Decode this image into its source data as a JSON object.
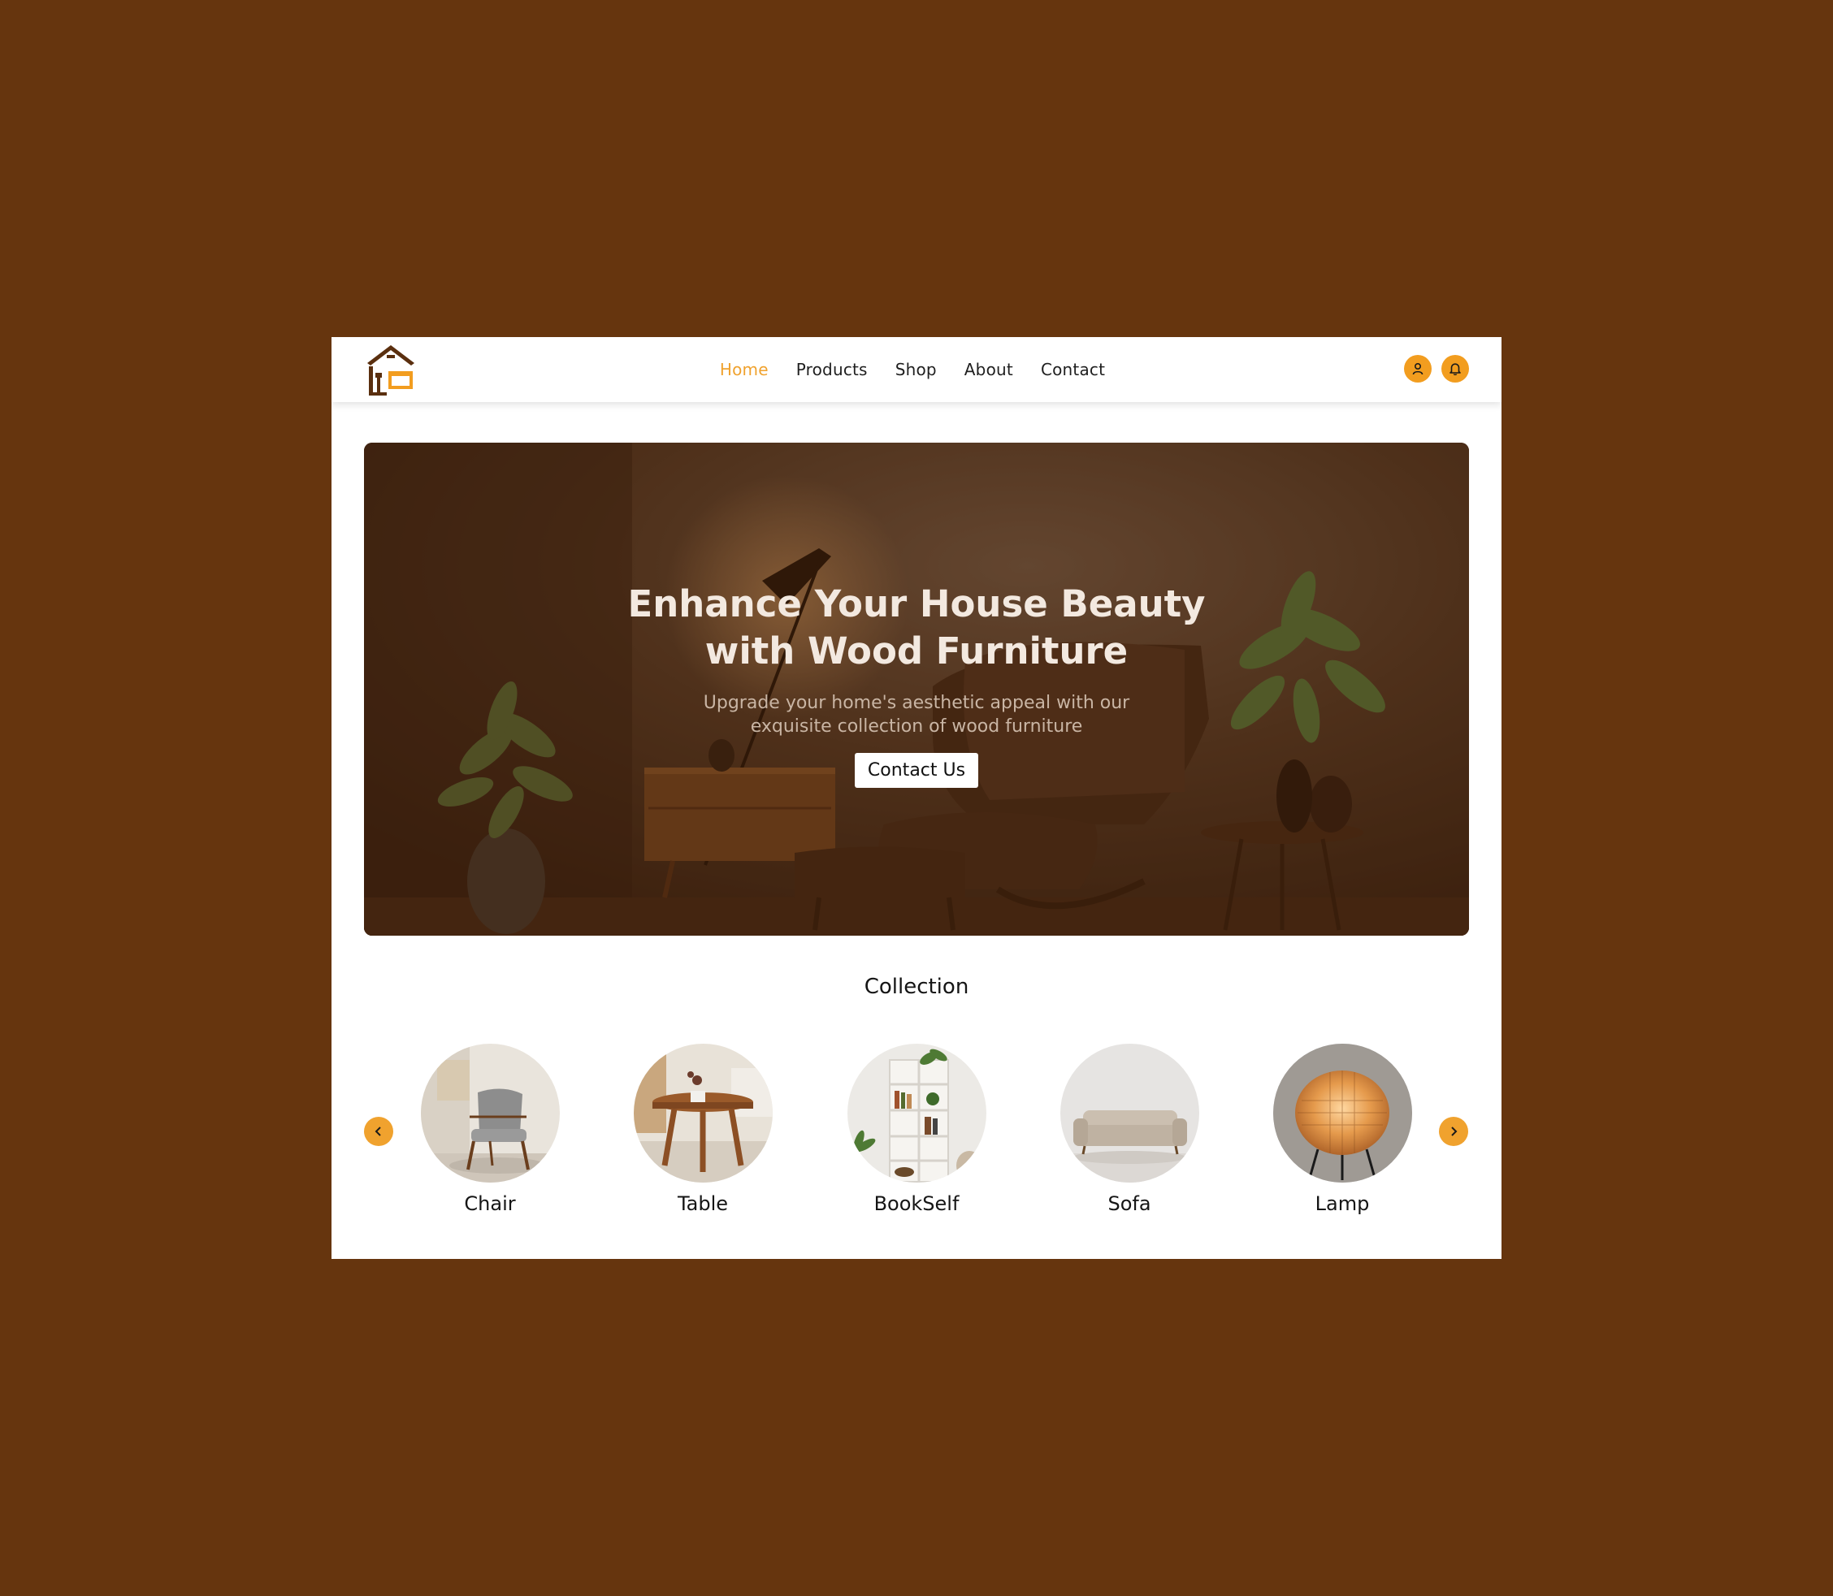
{
  "nav": {
    "links": [
      "Home",
      "Products",
      "Shop",
      "About",
      "Contact"
    ],
    "active": "Home",
    "icons": [
      "user-icon",
      "bell-icon"
    ]
  },
  "hero": {
    "title": "Enhance Your House Beauty with Wood Furniture",
    "subtitle": "Upgrade your home's aesthetic appeal with our exquisite collection of wood furniture",
    "button": "Contact Us"
  },
  "collection": {
    "title": "Collection",
    "items": [
      "Chair",
      "Table",
      "BookSelf",
      "Sofa",
      "Lamp"
    ]
  },
  "colors": {
    "background": "#66350e",
    "accent": "#f29d1f",
    "active_link": "#f0a22e"
  }
}
